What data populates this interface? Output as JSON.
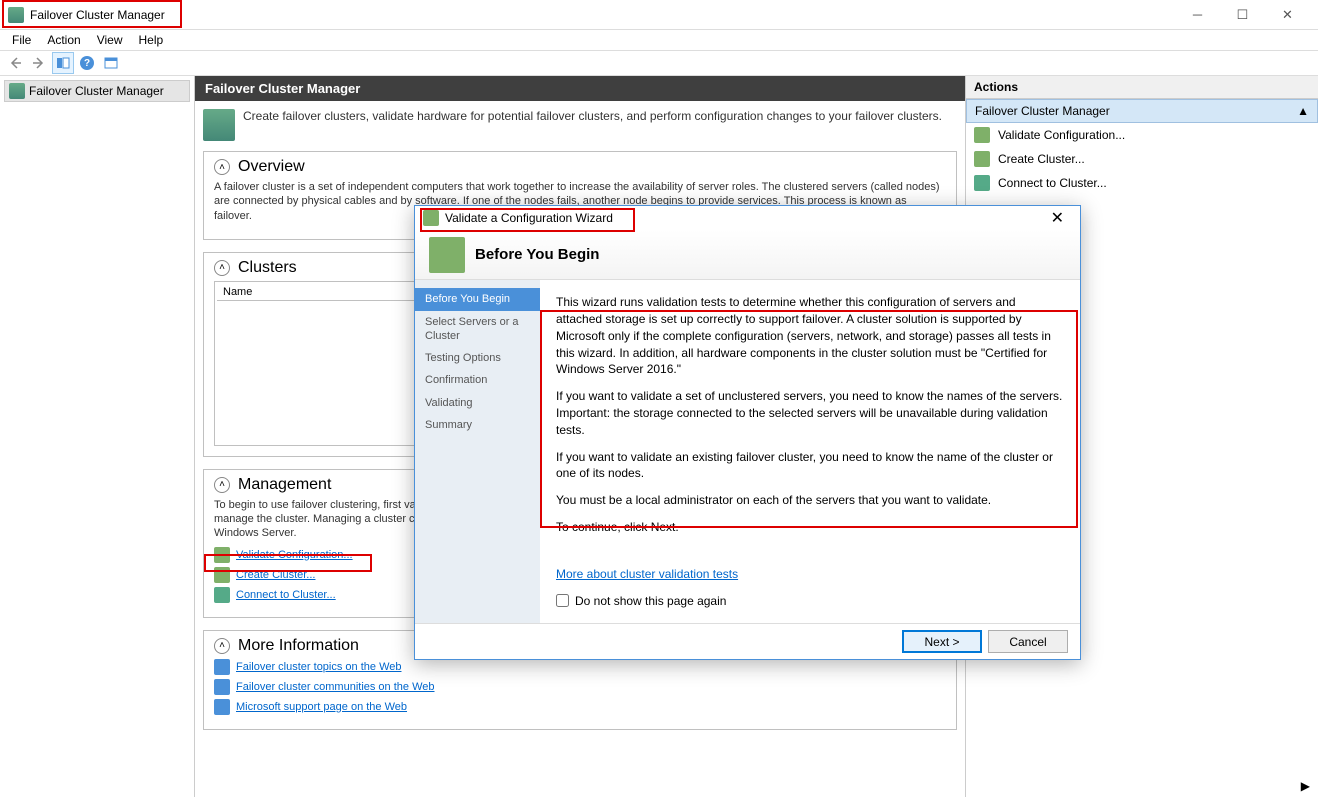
{
  "window": {
    "title": "Failover Cluster Manager"
  },
  "menu": {
    "file": "File",
    "action": "Action",
    "view": "View",
    "help": "Help"
  },
  "tree": {
    "root": "Failover Cluster Manager"
  },
  "center": {
    "header": "Failover Cluster Manager",
    "intro": "Create failover clusters, validate hardware for potential failover clusters, and perform configuration changes to your failover clusters.",
    "overview": {
      "title": "Overview",
      "desc": "A failover cluster is a set of independent computers that work together to increase the availability of server roles. The clustered servers (called nodes) are connected by physical cables and by software. If one of the nodes fails, another node begins to provide services. This process is known as failover."
    },
    "clusters": {
      "title": "Clusters",
      "col_name": "Name"
    },
    "management": {
      "title": "Management",
      "desc": "To begin to use failover clustering, first validate your hardware configuration, and then create a cluster. After these steps are complete, you can manage the cluster. Managing a cluster can include copying roles to it from a cluster running Windows Server 2016 or supported previous versions of Windows Server.",
      "validate": "Validate Configuration...",
      "create": "Create Cluster...",
      "connect": "Connect to Cluster..."
    },
    "moreinfo": {
      "title": "More Information",
      "topics": "Failover cluster topics on the Web",
      "communities": "Failover cluster communities on the Web",
      "support": "Microsoft support page on the Web"
    }
  },
  "actions": {
    "header": "Actions",
    "subheader": "Failover Cluster Manager",
    "validate": "Validate Configuration...",
    "create": "Create Cluster...",
    "connect": "Connect to Cluster..."
  },
  "wizard": {
    "title": "Validate a Configuration Wizard",
    "banner_title": "Before You Begin",
    "steps": {
      "s1": "Before You Begin",
      "s2": "Select Servers or a Cluster",
      "s3": "Testing Options",
      "s4": "Confirmation",
      "s5": "Validating",
      "s6": "Summary"
    },
    "p1": "This wizard runs validation tests to determine whether this configuration of servers and attached storage is set up correctly to support failover. A cluster solution is supported by Microsoft only if the complete configuration (servers, network, and storage) passes all tests in this wizard. In addition, all hardware components in the cluster solution must be \"Certified for Windows Server 2016.\"",
    "p2": "If you want to validate a set of unclustered servers, you need to know the names of the servers. Important: the storage connected to the selected servers will be unavailable during validation tests.",
    "p3": "If you want to validate an existing failover cluster, you need to know the name of the cluster or one of its nodes.",
    "p4": "You must be a local administrator on each of the servers that you want to validate.",
    "p5": "To continue, click Next.",
    "more_link": "More about cluster validation tests",
    "checkbox": "Do not show this page again",
    "btn_next": "Next >",
    "btn_cancel": "Cancel"
  }
}
